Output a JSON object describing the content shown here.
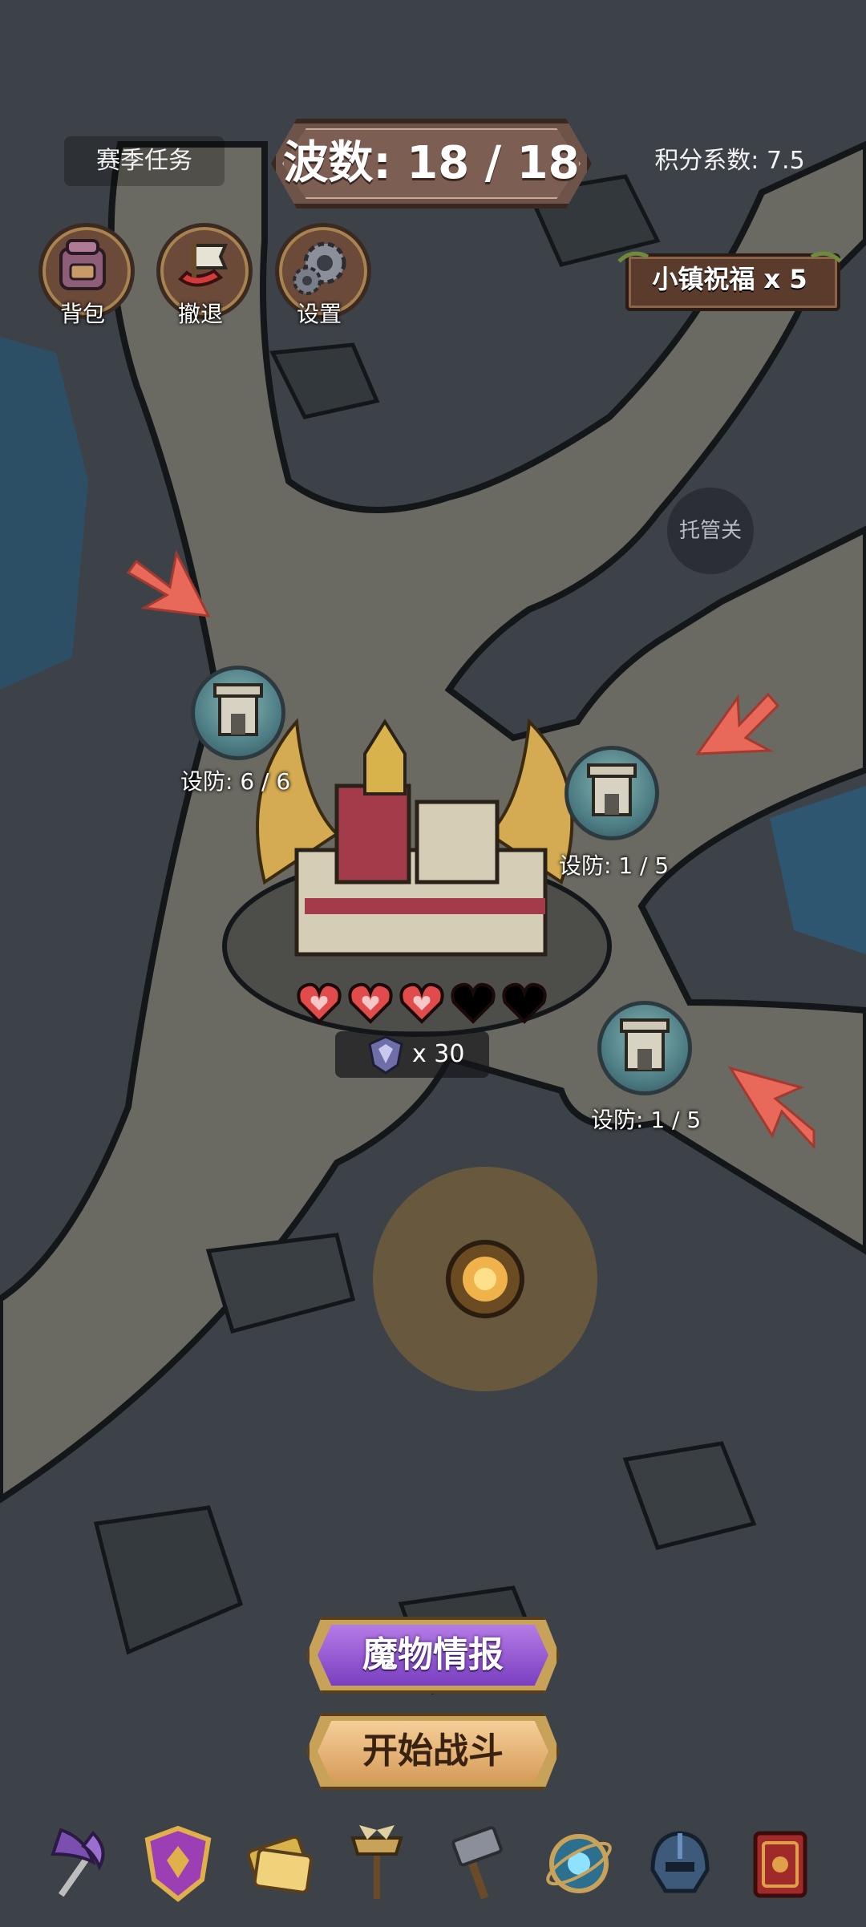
{
  "header": {
    "season_tasks": "赛季任务",
    "wave": "波数: 18 / 18",
    "score_coefficient": "积分系数: 7.5"
  },
  "top_buttons": [
    {
      "label": "背包",
      "icon": "backpack-icon"
    },
    {
      "label": "撤退",
      "icon": "retreat-flag-icon"
    },
    {
      "label": "设置",
      "icon": "gear-icon"
    }
  ],
  "town_blessing": "小镇祝福 x 5",
  "auto_toggle": "托管关",
  "towers": [
    {
      "label": "设防: 6 / 6"
    },
    {
      "label": "设防: 1 / 5"
    },
    {
      "label": "设防: 1 / 5"
    }
  ],
  "castle": {
    "hearts_full": 3,
    "hearts_total": 5,
    "reward_count": "x 30",
    "reward_icon": "shield-badge-icon"
  },
  "buttons": {
    "monster_info": "魔物情报",
    "start_battle": "开始战斗"
  },
  "bottom_bar": [
    {
      "icon": "battle-axe-icon"
    },
    {
      "icon": "crest-shield-icon"
    },
    {
      "icon": "tickets-icon"
    },
    {
      "icon": "winged-hammer-icon"
    },
    {
      "icon": "forge-hammer-icon"
    },
    {
      "icon": "magic-orb-icon"
    },
    {
      "icon": "helmet-icon"
    },
    {
      "icon": "spellbook-icon"
    }
  ],
  "colors": {
    "monster_button": "#8b4fd0",
    "start_button": "#e8b77a",
    "heart": "#e24b4b",
    "arrow": "#e8685a"
  }
}
